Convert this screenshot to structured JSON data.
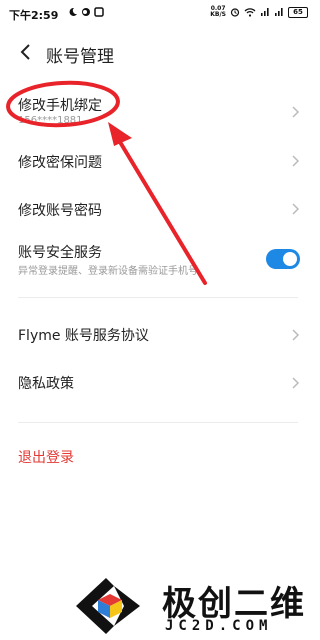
{
  "status_bar": {
    "time": "下午2:59",
    "speed": "0.07\nKB/S",
    "battery": "65"
  },
  "header": {
    "title": "账号管理"
  },
  "list": {
    "items": [
      {
        "label": "修改手机绑定",
        "sub": "156****1881"
      },
      {
        "label": "修改密保问题"
      },
      {
        "label": "修改账号密码"
      },
      {
        "label": "账号安全服务",
        "sub": "异常登录提醒、登录新设备需验证手机号",
        "toggle_on": true
      },
      {
        "label": "Flyme 账号服务协议"
      },
      {
        "label": "隐私政策"
      }
    ],
    "logout": "退出登录"
  },
  "watermark": {
    "cn": "极创二维",
    "en": "JC2D.COM"
  },
  "colors": {
    "accent": "#1e88e5",
    "danger": "#e53935",
    "annotation": "#e8232a"
  }
}
